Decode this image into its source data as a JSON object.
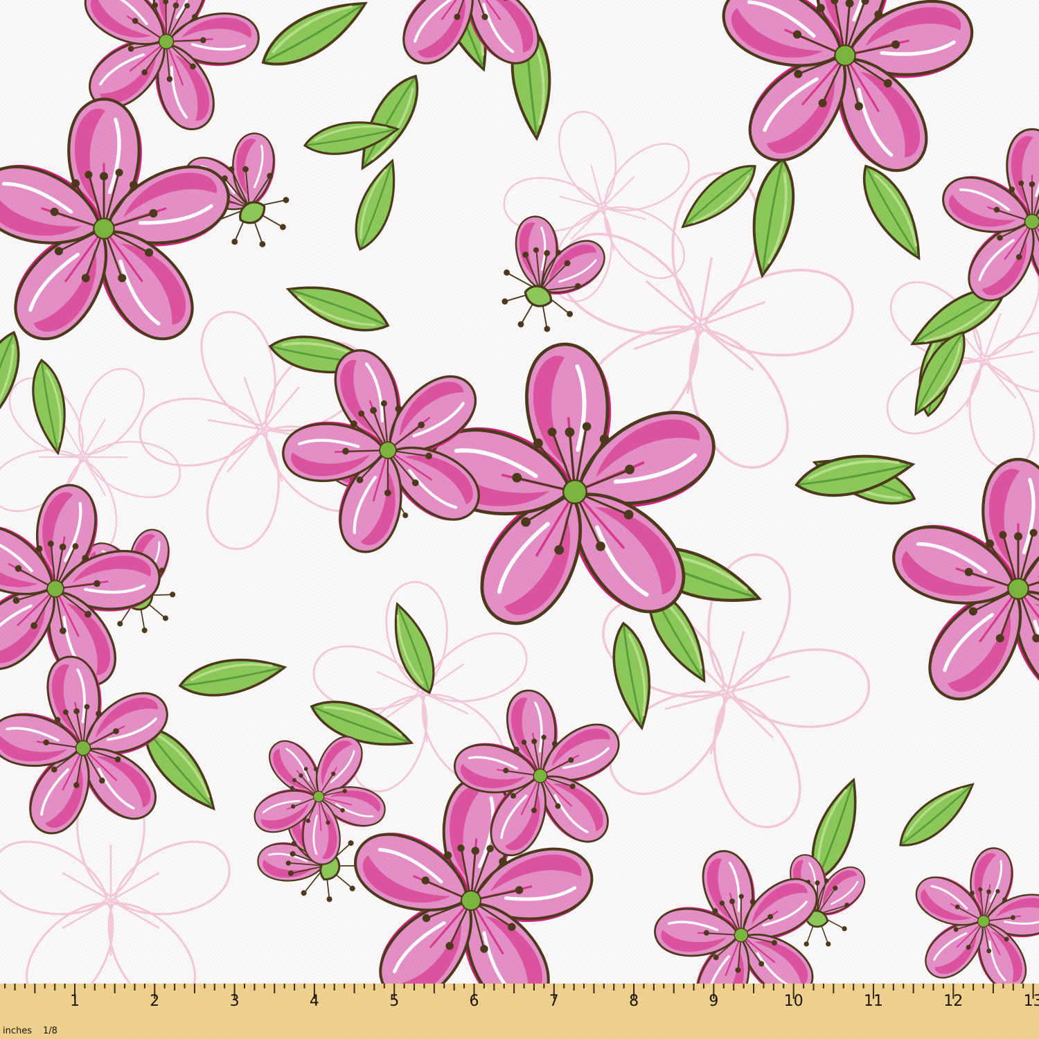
{
  "colors": {
    "fabric": "#fbf8f9",
    "petal": "#e48fc6",
    "petal_shadow": "#d6237f",
    "petal_outline": "#4d3a1c",
    "leaf": "#8cc85a",
    "leaf_dark": "#5a9c39",
    "center": "#7bb53f",
    "ghost_outline": "#f3c8d8",
    "ruler": "#efd08e"
  },
  "ruler": {
    "unit_label": "inches",
    "fraction_label": "1/8",
    "numbers": [
      "1",
      "2",
      "3",
      "4",
      "5",
      "6",
      "7",
      "8",
      "9",
      "10",
      "11",
      "12",
      "13"
    ]
  },
  "icons": {
    "flower": "five-petal-blossom",
    "leaf": "leaf"
  }
}
